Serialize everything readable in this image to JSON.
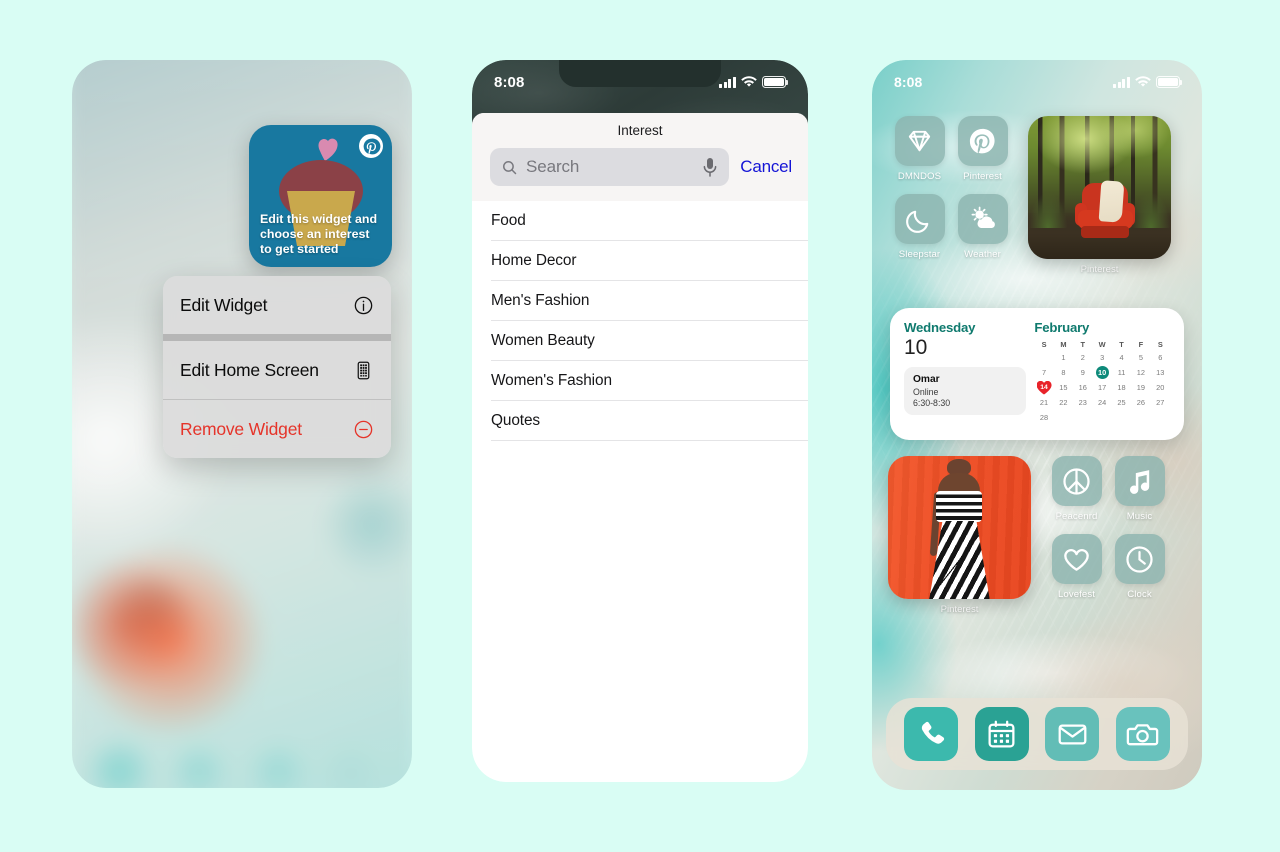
{
  "canvas": {
    "background": "#d9fdf4"
  },
  "phone1": {
    "name": "widget-context-menu-screen",
    "promo_widget": {
      "text": "Edit this widget and choose an interest to get started",
      "brand_icon": "pinterest-icon",
      "background_color": "#1878a0",
      "illustration": "cupcake-with-heart"
    },
    "context_menu": {
      "items": [
        {
          "label": "Edit Widget",
          "icon": "info-circle-icon",
          "style": "default"
        },
        {
          "label": "Edit Home Screen",
          "icon": "home-screen-grid-icon",
          "style": "default"
        },
        {
          "label": "Remove Widget",
          "icon": "minus-circle-icon",
          "style": "destructive"
        }
      ],
      "destructive_color": "#e5342a"
    }
  },
  "phone2": {
    "name": "interest-picker-screen",
    "status_bar": {
      "time": "8:08",
      "signal_icon": "cellular-signal-icon",
      "wifi_icon": "wifi-icon",
      "battery_icon": "battery-icon"
    },
    "sheet": {
      "title": "Interest",
      "search": {
        "placeholder": "Search",
        "value": "",
        "search_icon": "search-icon",
        "mic_icon": "microphone-icon"
      },
      "cancel_label": "Cancel",
      "cancel_color": "#1414d6",
      "items": [
        {
          "label": "Food"
        },
        {
          "label": "Home Decor"
        },
        {
          "label": "Men's Fashion"
        },
        {
          "label": "Women Beauty"
        },
        {
          "label": "Women's Fashion"
        },
        {
          "label": "Quotes"
        }
      ]
    }
  },
  "phone3": {
    "name": "home-screen",
    "status_bar": {
      "time": "8:08",
      "signal_icon": "cellular-signal-icon",
      "wifi_icon": "wifi-icon",
      "battery_icon": "battery-icon"
    },
    "apps_row1": [
      {
        "label": "DMNDOS",
        "icon": "diamond-icon"
      },
      {
        "label": "Pinterest",
        "icon": "pinterest-icon"
      }
    ],
    "apps_row2": [
      {
        "label": "Sleepstar",
        "icon": "moon-icon"
      },
      {
        "label": "Weather",
        "icon": "sun-cloud-icon"
      }
    ],
    "photo_widget_top": {
      "label": "Pinterest",
      "image": "red-armchair-in-forest"
    },
    "photo_widget_bottom": {
      "label": "Pinterest",
      "image": "woman-in-striped-dress-orange-backdrop"
    },
    "apps_row3": [
      {
        "label": "Peacenrd",
        "icon": "peace-icon"
      },
      {
        "label": "Music",
        "icon": "music-note-icon"
      }
    ],
    "apps_row4": [
      {
        "label": "Lovefest",
        "icon": "heart-icon"
      },
      {
        "label": "Clock",
        "icon": "clock-icon"
      }
    ],
    "calendar_widget": {
      "day_of_week": "Wednesday",
      "day_number": "10",
      "month": "February",
      "accent_color": "#0f7a6e",
      "event": {
        "title": "Omar",
        "subtitle": "Online",
        "time": "6:30-8:30"
      },
      "weekday_headers": [
        "S",
        "M",
        "T",
        "W",
        "T",
        "F",
        "S"
      ],
      "weeks": [
        [
          "",
          "1",
          "2",
          "3",
          "4",
          "5",
          "6"
        ],
        [
          "7",
          "8",
          "9",
          "10",
          "11",
          "12",
          "13"
        ],
        [
          "14",
          "15",
          "16",
          "17",
          "18",
          "19",
          "20"
        ],
        [
          "21",
          "22",
          "23",
          "24",
          "25",
          "26",
          "27"
        ],
        [
          "28",
          "",
          "",
          "",
          "",
          "",
          ""
        ]
      ],
      "today": "10",
      "heart_day": "14"
    },
    "dock": [
      {
        "label": "Phone",
        "icon": "phone-icon",
        "color": "#3cb9ad"
      },
      {
        "label": "Calendar",
        "icon": "calendar-icon",
        "color": "#2aa294"
      },
      {
        "label": "Mail",
        "icon": "mail-icon",
        "color": "#62bdb6"
      },
      {
        "label": "Camera",
        "icon": "camera-icon",
        "color": "#69c2bd"
      }
    ]
  }
}
